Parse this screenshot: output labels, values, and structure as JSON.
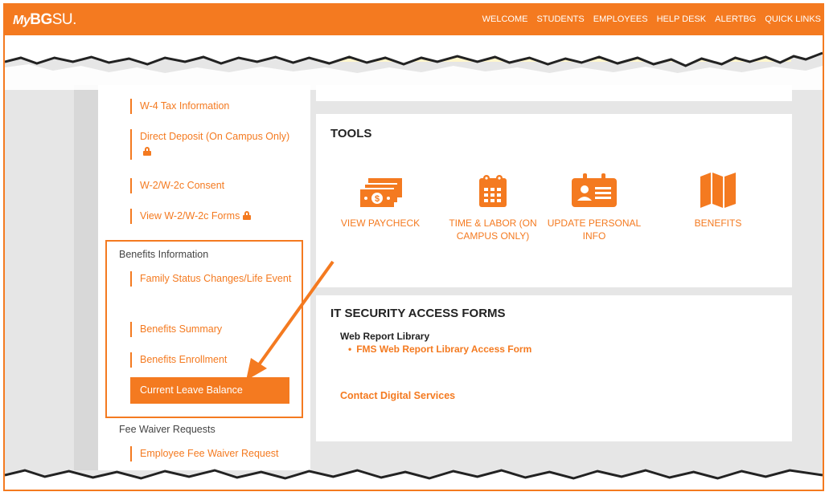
{
  "header": {
    "logo_my": "My",
    "logo_bg": "BG",
    "logo_su": "SU.",
    "nav": [
      "WELCOME",
      "STUDENTS",
      "EMPLOYEES",
      "HELP DESK",
      "ALERTBG",
      "QUICK LINKS"
    ]
  },
  "sidebar": {
    "payroll_items": [
      "W-4 Tax Information",
      "Direct Deposit (On Campus Only)",
      "W-2/W-2c Consent",
      "View W-2/W-2c Forms"
    ],
    "benefits_heading": "Benefits Information",
    "benefits_items": [
      "Family Status Changes/Life Event",
      "Benefits Summary",
      "Benefits Enrollment"
    ],
    "active_item": "Current Leave Balance",
    "fee_heading": "Fee Waiver Requests",
    "fee_items": [
      "Employee Fee Waiver Request"
    ]
  },
  "tools": {
    "title": "TOOLS",
    "items": [
      {
        "label": "VIEW PAYCHECK",
        "icon": "money-icon"
      },
      {
        "label": "TIME & LABOR (ON CAMPUS ONLY)",
        "icon": "calendar-icon"
      },
      {
        "label": "UPDATE PERSONAL INFO",
        "icon": "id-card-icon"
      },
      {
        "label": "BENEFITS",
        "icon": "map-icon"
      }
    ]
  },
  "security": {
    "title": "IT SECURITY ACCESS FORMS",
    "library_heading": "Web Report Library",
    "library_link": "FMS Web Report Library Access Form",
    "contact_link": "Contact Digital Services"
  },
  "colors": {
    "accent": "#f47a20",
    "background": "#e6e6e6"
  }
}
